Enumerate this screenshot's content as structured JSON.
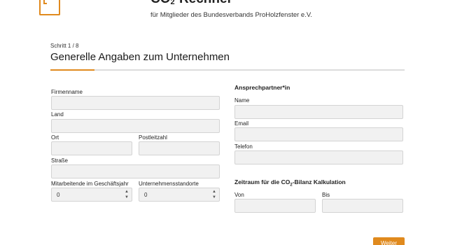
{
  "header": {
    "title_prefix": "CO",
    "title_sub": "2",
    "title_suffix": "-Rechner",
    "subtitle": "für Mitglieder des Bundesverbands ProHolzfenster e.V."
  },
  "step": {
    "label": "Schritt 1 / 8",
    "title": "Generelle Angaben zum Unternehmen",
    "progress_fraction": 0.125
  },
  "left_form": {
    "company_label": "Firmenname",
    "country_label": "Land",
    "city_label": "Ort",
    "zip_label": "Postleitzahl",
    "street_label": "Straße",
    "employees_label": "Mitarbeitende im Geschäftsjahr",
    "employees_value": "0",
    "sites_label": "Unternehmensstandorte",
    "sites_value": "0"
  },
  "right_form": {
    "contact_heading": "Ansprechpartner*in",
    "name_label": "Name",
    "email_label": "Email",
    "phone_label": "Telefon",
    "period_heading_prefix": "Zeitraum für die CO",
    "period_heading_sub": "2",
    "period_heading_suffix": "-Bilanz Kalkulation",
    "from_label": "Von",
    "to_label": "Bis"
  },
  "actions": {
    "next_label": "Weiter"
  },
  "colors": {
    "accent": "#e08a1e",
    "field_bg": "#f1f1f1",
    "field_border": "#d3d3d3"
  },
  "icons": {
    "spinner_up": "▲",
    "spinner_down": "▼"
  }
}
